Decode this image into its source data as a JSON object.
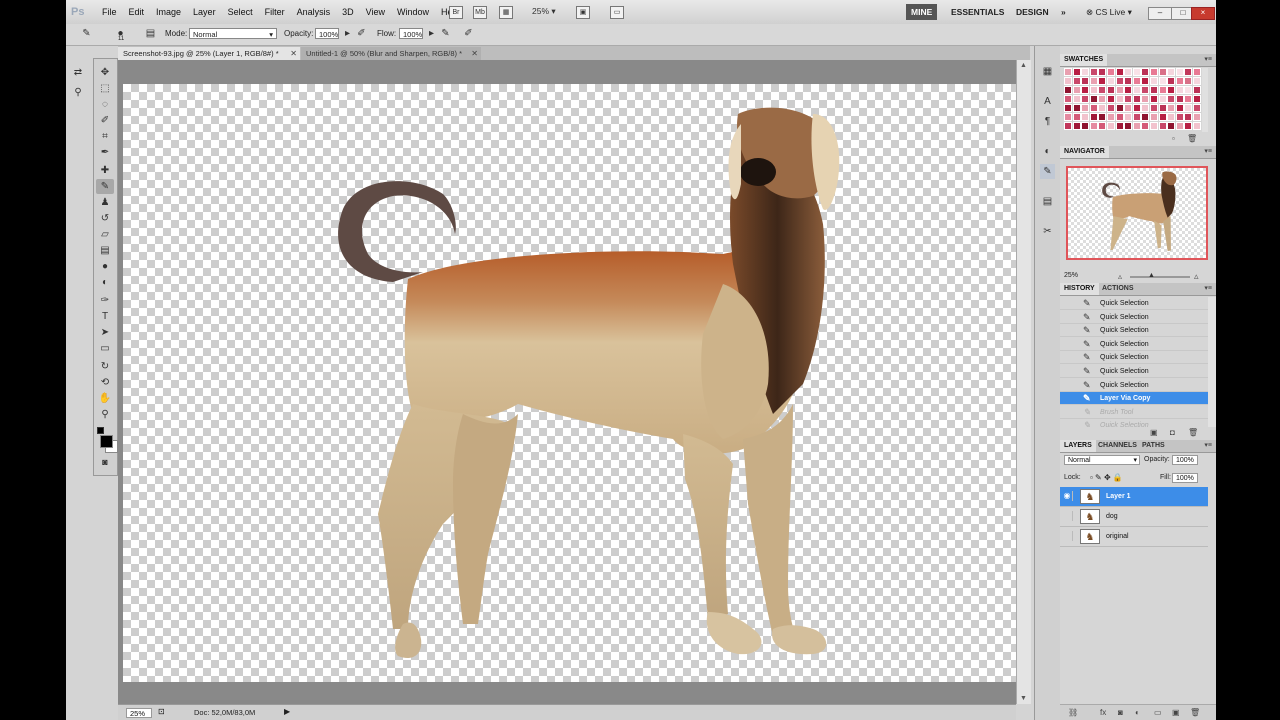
{
  "app": {
    "logo_text": "Ps"
  },
  "menu": [
    "File",
    "Edit",
    "Image",
    "Layer",
    "Select",
    "Filter",
    "Analysis",
    "3D",
    "View",
    "Window",
    "Help"
  ],
  "menubar_icons": {
    "bridge": "Br",
    "minibridge": "Mb",
    "zoom": "25%"
  },
  "workspaces": {
    "mine": "MINE",
    "essentials": "ESSENTIALS",
    "design": "DESIGN",
    "more": "»"
  },
  "cs_live": "CS Live",
  "options": {
    "brush_size": "11",
    "mode_label": "Mode:",
    "mode_value": "Normal",
    "opacity_label": "Opacity:",
    "opacity_value": "100%",
    "flow_label": "Flow:",
    "flow_value": "100%"
  },
  "tabs": [
    {
      "label": "Screenshot-93.jpg @ 25% (Layer 1, RGB/8#) *"
    },
    {
      "label": "Untitled-1 @ 50% (Blur and Sharpen, RGB/8) *"
    }
  ],
  "status": {
    "zoom": "25%",
    "doc": "Doc: 52,0M/83,0M"
  },
  "panels": {
    "swatches": "SWATCHES",
    "navigator": "NAVIGATOR",
    "nav_zoom": "25%",
    "history": "HISTORY",
    "actions": "ACTIONS",
    "history_items": [
      "Quick Selection",
      "Quick Selection",
      "Quick Selection",
      "Quick Selection",
      "Quick Selection",
      "Quick Selection",
      "Quick Selection",
      "Layer Via Copy",
      "Brush Tool",
      "Quick Selection"
    ],
    "history_selected_index": 7,
    "layers": "LAYERS",
    "channels": "CHANNELS",
    "paths": "PATHS",
    "blend_mode": "Normal",
    "opacity_label": "Opacity:",
    "opacity_value": "100%",
    "lock_label": "Lock:",
    "fill_label": "Fill:",
    "fill_value": "100%",
    "layer_items": [
      {
        "name": "Layer 1",
        "selected": true,
        "visible": true
      },
      {
        "name": "dog",
        "selected": false,
        "visible": false
      },
      {
        "name": "original",
        "selected": false,
        "visible": false
      }
    ]
  },
  "colors": {
    "selection": "#3d8de8",
    "swatch_base": "#d45a78"
  }
}
